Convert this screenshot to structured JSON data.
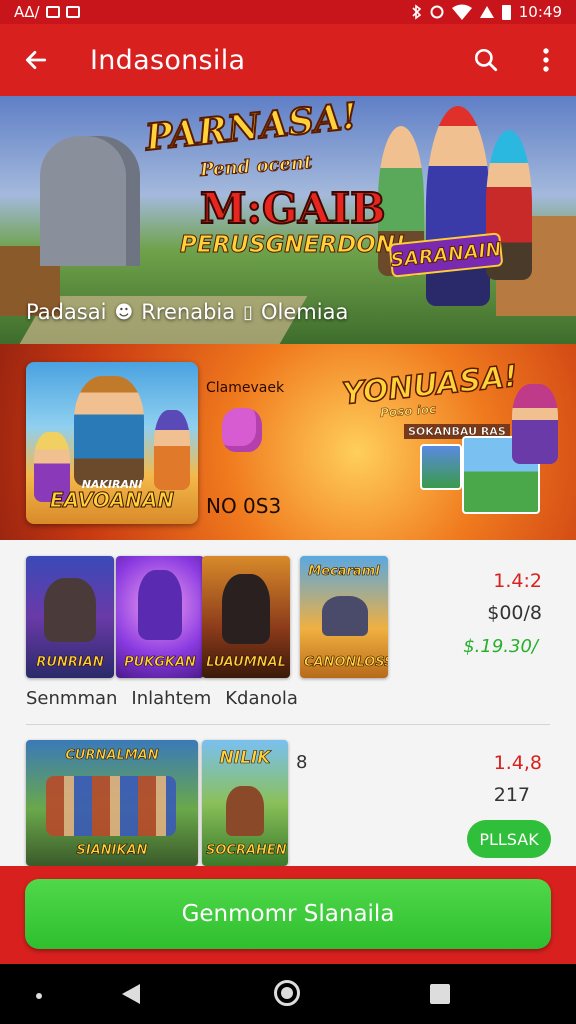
{
  "status_bar": {
    "left_text": "AΔ/",
    "time": "10:49",
    "icons": [
      "sim-icon",
      "notification-icon",
      "bluetooth-icon",
      "alarm-icon",
      "wifi-icon",
      "signal-icon",
      "battery-icon"
    ]
  },
  "app_bar": {
    "title": "Indasonsila",
    "icons": [
      "back-arrow-icon",
      "search-icon",
      "more-vert-icon"
    ]
  },
  "hero": {
    "title_line1": "PARNASA!",
    "title_line2": "Pend ocent",
    "title_line3": "M:GAIB",
    "title_line4": "PERUSGNERDON!",
    "badge": "SARANAIN",
    "meta_1": "Padasai",
    "meta_2": "Rrenabia",
    "meta_3": "Olemiaa"
  },
  "promo": {
    "art_title": "EAVOANAN",
    "art_subtitle": "NAKIRANI",
    "label": "Clamevaek",
    "code": "NO 0S3",
    "title": "YONUASA!",
    "subtitle": "Poso ioc",
    "subtitle2": "SOKANBAU RAS"
  },
  "list": {
    "row1": {
      "thumbs": [
        "RUNRIAN",
        "PUKGKAN",
        "LUAUMNAL",
        "CANONLOSS"
      ],
      "thumb_top": "Mecaraml",
      "labels": [
        "Senmman",
        "Inlahtem",
        "Kdanola"
      ],
      "price_a": "1.4:2",
      "price_b": "$00/8",
      "price_c": "$.19.30/"
    },
    "row2": {
      "thumbs": [
        "SIANIKAN",
        "SOCRAHEN"
      ],
      "thumb_top_1": "CURNALMAN",
      "thumb_top_2": "NILIK",
      "x_label": "8",
      "price_a": "1.4,8",
      "price_b": "217",
      "button": "PLLSAK"
    }
  },
  "bottom_button": "Genmomr Slanaila",
  "colors": {
    "primary_red": "#d8201f",
    "status_red": "#c8141b",
    "green": "#2fbf3a",
    "price_red": "#d8201f",
    "price_green": "#27b02b"
  }
}
